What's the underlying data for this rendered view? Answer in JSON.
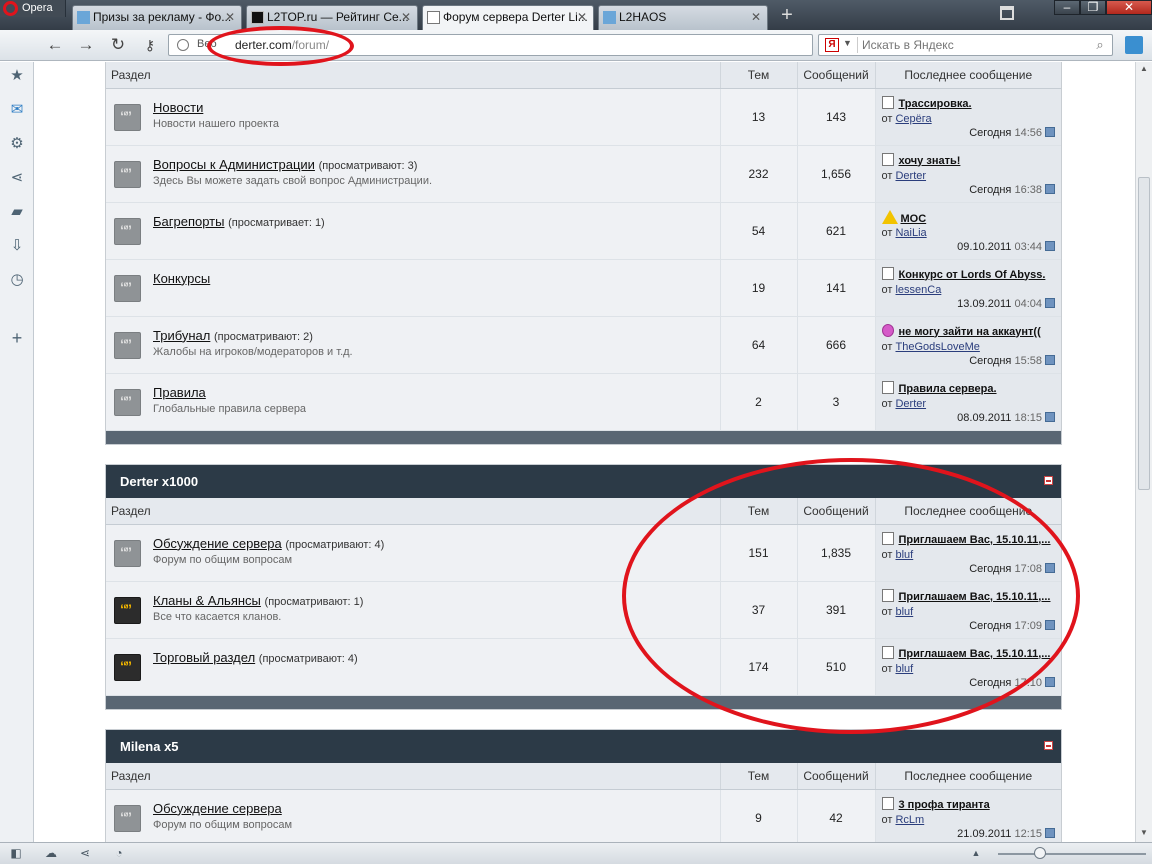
{
  "browser": {
    "app_name": "Opera",
    "tabs": [
      {
        "label": "Призы за рекламу - Фо..."
      },
      {
        "label": "L2TOP.ru — Рейтинг Се..."
      },
      {
        "label": "Форум сервера Derter Li..."
      },
      {
        "label": "L2HAOS"
      }
    ],
    "close_glyph": "✕",
    "address": {
      "prefix": "Веб",
      "host": "derter.com",
      "path": "/forum/"
    },
    "search": {
      "engine": "Я",
      "placeholder": "Искать в Яндекс"
    }
  },
  "columns": {
    "section": "Раздел",
    "threads": "Тем",
    "posts": "Сообщений",
    "last": "Последнее сообщение"
  },
  "from_label": "от",
  "categories": [
    {
      "name": "",
      "forums": [
        {
          "title": "Новости",
          "viewing": "",
          "desc": "Новости нашего проекта",
          "threads": "13",
          "posts": "143",
          "last_title": "Трассировка.",
          "last_icon": "post-icon",
          "last_user": "Серёга",
          "last_date": "Сегодня",
          "last_time": "14:56"
        },
        {
          "title": "Вопросы к Администрации",
          "viewing": "(просматривают: 3)",
          "desc": "Здесь Вы можете задать свой вопрос Администрации.",
          "threads": "232",
          "posts": "1,656",
          "last_title": "хочу знать!",
          "last_icon": "post-icon",
          "last_user": "Derter",
          "last_date": "Сегодня",
          "last_time": "16:38"
        },
        {
          "title": "Багрепорты",
          "viewing": "(просматривает: 1)",
          "desc": "",
          "threads": "54",
          "posts": "621",
          "last_title": "МОС",
          "last_icon": "warning-icon",
          "last_user": "NaiLia",
          "last_date": "09.10.2011",
          "last_time": "03:44"
        },
        {
          "title": "Конкурсы",
          "viewing": "",
          "desc": "",
          "threads": "19",
          "posts": "141",
          "last_title": "Конкурс от Lords Of Abyss.",
          "last_icon": "post-icon",
          "last_user": "lessenCa",
          "last_date": "13.09.2011",
          "last_time": "04:04"
        },
        {
          "title": "Трибунал",
          "viewing": "(просматривают: 2)",
          "desc": "Жалобы на игроков/модераторов и т.д.",
          "threads": "64",
          "posts": "666",
          "last_title": "не могу зайти на аккаунт((",
          "last_icon": "smile-icon",
          "last_user": "TheGodsLoveMe",
          "last_date": "Сегодня",
          "last_time": "15:58"
        },
        {
          "title": "Правила",
          "viewing": "",
          "desc": "Глобальные правила сервера",
          "threads": "2",
          "posts": "3",
          "last_title": "Правила сервера.",
          "last_icon": "post-icon",
          "last_user": "Derter",
          "last_date": "08.09.2011",
          "last_time": "18:15"
        }
      ]
    },
    {
      "name": "Derter x1000",
      "forums": [
        {
          "title": "Обсуждение сервера",
          "viewing": "(просматривают: 4)",
          "desc": "Форум по общим вопросам",
          "threads": "151",
          "posts": "1,835",
          "last_title": "Приглашаем Вас, 15.10.11,...",
          "last_icon": "post-icon",
          "last_user": "bluf",
          "last_date": "Сегодня",
          "last_time": "17:08"
        },
        {
          "title": "Кланы & Альянсы",
          "viewing": "(просматривают: 1)",
          "desc": "Все что касается кланов.",
          "threads": "37",
          "posts": "391",
          "last_title": "Приглашаем Вас, 15.10.11,...",
          "last_icon": "post-icon",
          "last_user": "bluf",
          "last_date": "Сегодня",
          "last_time": "17:09"
        },
        {
          "title": "Торговый раздел",
          "viewing": "(просматривают: 4)",
          "desc": "",
          "threads": "174",
          "posts": "510",
          "last_title": "Приглашаем Вас, 15.10.11,...",
          "last_icon": "post-icon",
          "last_user": "bluf",
          "last_date": "Сегодня",
          "last_time": "17:10"
        }
      ]
    },
    {
      "name": "Milena x5",
      "forums": [
        {
          "title": "Обсуждение сервера",
          "viewing": "",
          "desc": "Форум по общим вопросам",
          "threads": "9",
          "posts": "42",
          "last_title": "3 профа тиранта",
          "last_icon": "post-icon",
          "last_user": "RcLm",
          "last_date": "21.09.2011",
          "last_time": "12:15"
        }
      ]
    }
  ],
  "colors": {
    "annotation": "#e0141c",
    "category_header": "#2c3a47",
    "link": "#2a3d7c"
  }
}
